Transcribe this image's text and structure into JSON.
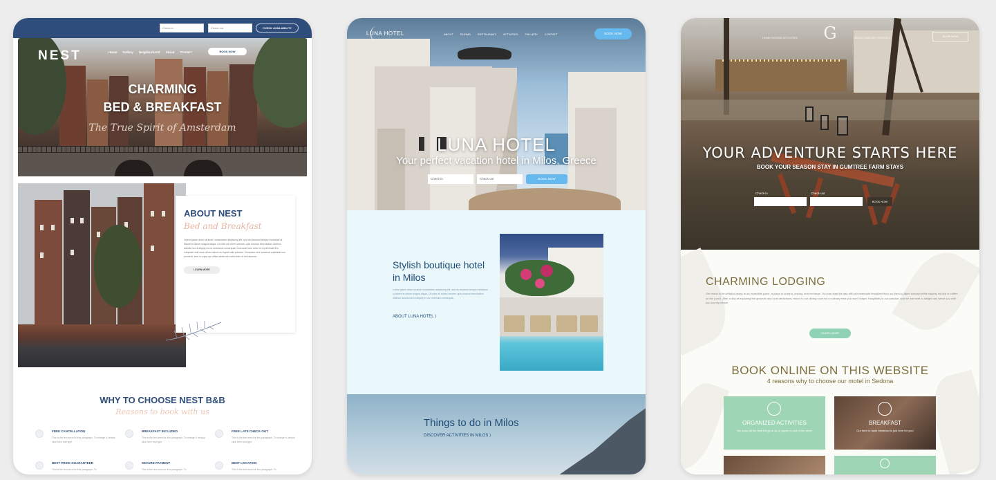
{
  "nest": {
    "topbar": {
      "checkin_placeholder": "Check-in",
      "checkout_placeholder": "Check-out",
      "availability_button": "CHECK AVAILABILITY"
    },
    "logo": "NEST",
    "nav": [
      "Home",
      "Gallery",
      "Neighborhood",
      "About",
      "Contact"
    ],
    "book_button": "BOOK NOW",
    "hero_title_line1": "CHARMING",
    "hero_title_line2": "BED & BREAKFAST",
    "hero_script": "The True Spirit of Amsterdam",
    "about_title": "ABOUT NEST",
    "about_script": "Bed and Breakfast",
    "about_text": "Lorem ipsum dolor sit amet, consectetur adipiscing elit, sed do eiusmod tempor incididunt ut labore et dolore magna aliqua. Ut enim ad minim veniam, quis nostrud exercitation ullamco laboris nisi ut aliquip ex ea commodo consequat. Duis aute irure dolor in reprehenderit in voluptate velit esse cillum dolore eu fugiat nulla pariatur. Excepteur sint occaecat cupidatat non proident, sunt in culpa qui officia deserunt mollit anim id est laborum.",
    "about_button": "LEARN MORE",
    "why_title": "WHY TO CHOOSE NEST B&B",
    "why_script": "Reasons to book with us",
    "features": [
      {
        "title": "FREE CANCELLATION",
        "desc": "This is the text area for this paragraph. To change it, simply click here and type."
      },
      {
        "title": "BREAKFAST INCLUDED",
        "desc": "This is the text area for this paragraph. To change it, simply click here and type."
      },
      {
        "title": "FREE LATE CHECK-OUT",
        "desc": "This is the text area for this paragraph. To change it, simply click here and type."
      },
      {
        "title": "BEST PRICE GUARANTEED",
        "desc": "This is the text area for this paragraph. To"
      },
      {
        "title": "SECURE PAYMENT",
        "desc": "This is the text area for this paragraph. To"
      },
      {
        "title": "BEST LOCATION",
        "desc": "This is the text area for this paragraph. To"
      }
    ]
  },
  "luna": {
    "logo": "LUNA HOTEL",
    "nav": [
      "ABOUT",
      "ROOMS",
      "RESTAURANT",
      "ACTIVITIES",
      "GALLERY",
      "CONTACT"
    ],
    "book_button": "BOOK NOW",
    "hero_title": "LUNA HOTEL",
    "hero_sub": "Your perfect vacation hotel in Milos, Greece",
    "checkin_placeholder": "Check-in",
    "checkout_placeholder": "Check-out",
    "form_button": "BOOK NOW",
    "about_title": "Stylish boutique hotel in Milos",
    "about_text": "Lorem ipsum dolor sit amet consectetur adipiscing elit, sed do eiusmod tempor incididunt ut labore et dolore magna aliqua. Ut enim ad minim veniam, quis nostrud exercitation ullamco laboris nisi ut aliquip ex ea commodo consequat.",
    "about_link": "ABOUT LUNA HOTEL",
    "things_title": "Things to do in Milos",
    "things_link": "DISCOVER ACTIVITIES IN MILOS"
  },
  "farm": {
    "nav_left": "HOME   ROOMS   ACTIVITIES",
    "nav_right": "DINING   GALLERY   CONTACT",
    "book_button": "BOOK NOW",
    "monogram": "G",
    "hero_title": "YOUR ADVENTURE STARTS HERE",
    "hero_sub": "BOOK YOUR SEASON STAY IN GUMTREE FARM STAYS",
    "checkin_label": "Check-in",
    "checkout_label": "Check-out",
    "form_button": "BOOK NOW",
    "lodging_title": "CHARMING LODGING",
    "lodging_text": "Get ready to be whisked away to an incredible place, a place to unwind, unplug, and recharge. You can start the day with a homemade breakfast from our farm-to-table concept while sipping hot tea or coffee on the porch. After a day of exploring the grounds and local attractions, return to our dining room for a culinary treat you won't forget. Hospitality is our passion, and we are here to delight and serve you with our country charm.",
    "lodging_button": "LEARN MORE",
    "book_title": "BOOK ONLINE ON THIS WEBSITE",
    "book_sub": "4 reasons why to choose our motel in Sedona",
    "tiles": [
      {
        "title": "ORGANIZED ACTIVITIES",
        "desc": "We know all the best things to do & places to visit in the area!"
      },
      {
        "title": "BREAKFAST",
        "desc": "Our farm to table breakfast is just here for you!"
      }
    ]
  }
}
